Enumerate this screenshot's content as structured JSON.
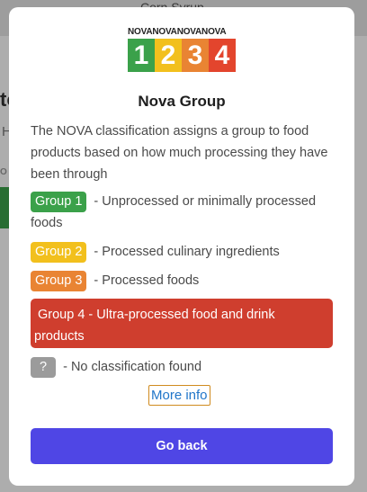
{
  "background": {
    "hero_text": "Corn Syrup",
    "partial_letter_t": "to",
    "partial_letter_h": "H",
    "partial_letter_o": "O"
  },
  "modal": {
    "logo": {
      "strip_text": "NOVANOVANOVANOVA",
      "digits": [
        "1",
        "2",
        "3",
        "4"
      ],
      "colors": [
        "#3ba14a",
        "#f2c01d",
        "#e98433",
        "#e3452d"
      ]
    },
    "title": "Nova Group",
    "description": "The NOVA classification assigns a group to food products based on how much processing they have been through",
    "groups": [
      {
        "badge": "Group 1",
        "text": " - Unprocessed or minimally processed foods",
        "color": "#3ba14a"
      },
      {
        "badge": "Group 2",
        "text": " - Processed culinary ingredients",
        "color": "#f2c01d"
      },
      {
        "badge": "Group 3",
        "text": " - Processed foods",
        "color": "#e98433"
      },
      {
        "badge": "Group 4",
        "text": "  - Ultra-processed food and drink products",
        "color": "#cf3e2e"
      },
      {
        "badge": "?",
        "text": " - No classification found",
        "color": "#9b9b9b"
      }
    ],
    "more_info_label": "More info",
    "go_back_label": "Go back",
    "go_back_color": "#4f46e5"
  }
}
